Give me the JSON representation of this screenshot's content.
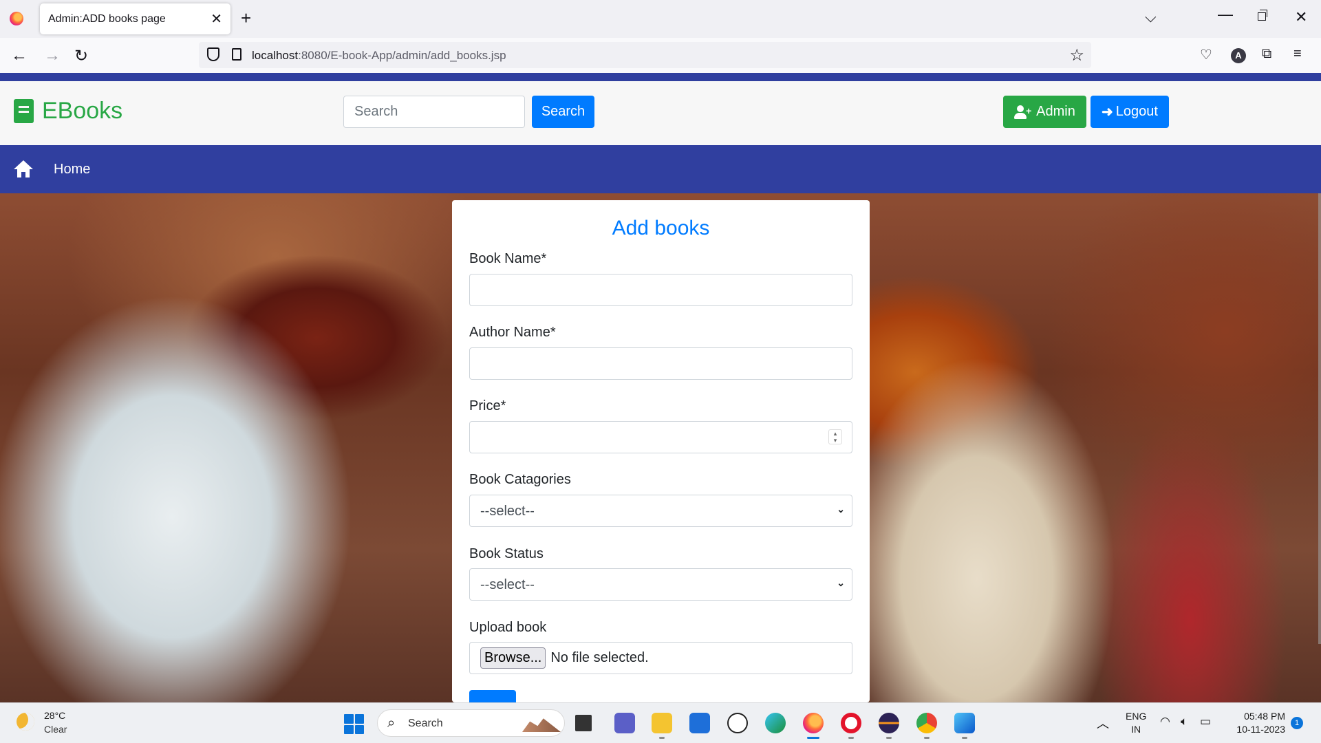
{
  "browser": {
    "tab_title": "Admin:ADD books page",
    "url_host": "localhost",
    "url_path": ":8080/E-book-App/admin/add_books.jsp"
  },
  "header": {
    "brand": "EBooks",
    "search_placeholder": "Search",
    "search_button": "Search",
    "admin_button": "Admin",
    "logout_button": "Logout"
  },
  "menu": {
    "home": "Home"
  },
  "form": {
    "title": "Add books",
    "book_name_label": "Book Name*",
    "author_name_label": "Author Name*",
    "price_label": "Price*",
    "categories_label": "Book Catagories",
    "categories_value": "--select--",
    "status_label": "Book Status",
    "status_value": "--select--",
    "upload_label": "Upload book",
    "browse_button": "Browse...",
    "file_status": "No file selected."
  },
  "taskbar": {
    "temperature": "28°C",
    "condition": "Clear",
    "search_label": "Search",
    "lang_line1": "ENG",
    "lang_line2": "IN",
    "time": "05:48 PM",
    "date": "10-11-2023",
    "notification_count": "1"
  },
  "colors": {
    "brand_green": "#28a745",
    "primary_blue": "#007bff",
    "navy_bar": "#303f9f"
  }
}
